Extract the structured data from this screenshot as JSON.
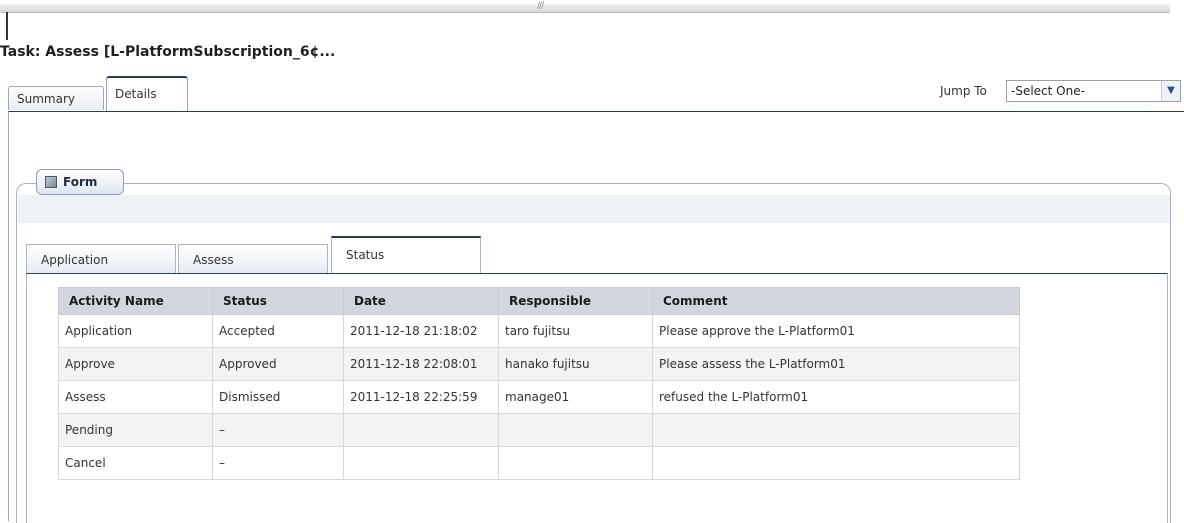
{
  "header": {
    "title": "Task: Assess [L-PlatformSubscription_6¢..."
  },
  "top_tabs": [
    {
      "label": "Summary",
      "active": false
    },
    {
      "label": "Details",
      "active": true
    }
  ],
  "jump_to": {
    "label": "Jump To",
    "selected": "-Select One-"
  },
  "form": {
    "legend": "Form",
    "tabs": [
      {
        "label": "Application",
        "active": false
      },
      {
        "label": "Assess",
        "active": false
      },
      {
        "label": "Status",
        "active": true
      }
    ]
  },
  "status_table": {
    "columns": [
      "Activity Name",
      "Status",
      "Date",
      "Responsible",
      "Comment"
    ],
    "rows": [
      [
        "Application",
        "Accepted",
        "2011-12-18 21:18:02",
        "taro fujitsu",
        "Please approve the L-Platform01"
      ],
      [
        "Approve",
        "Approved",
        "2011-12-18 22:08:01",
        "hanako fujitsu",
        "Please assess the L-Platform01"
      ],
      [
        "Assess",
        "Dismissed",
        "2011-12-18 22:25:59",
        "manage01",
        "refused the L-Platform01"
      ],
      [
        "Pending",
        "–",
        "",
        "",
        ""
      ],
      [
        "Cancel",
        "–",
        "",
        "",
        ""
      ]
    ]
  }
}
